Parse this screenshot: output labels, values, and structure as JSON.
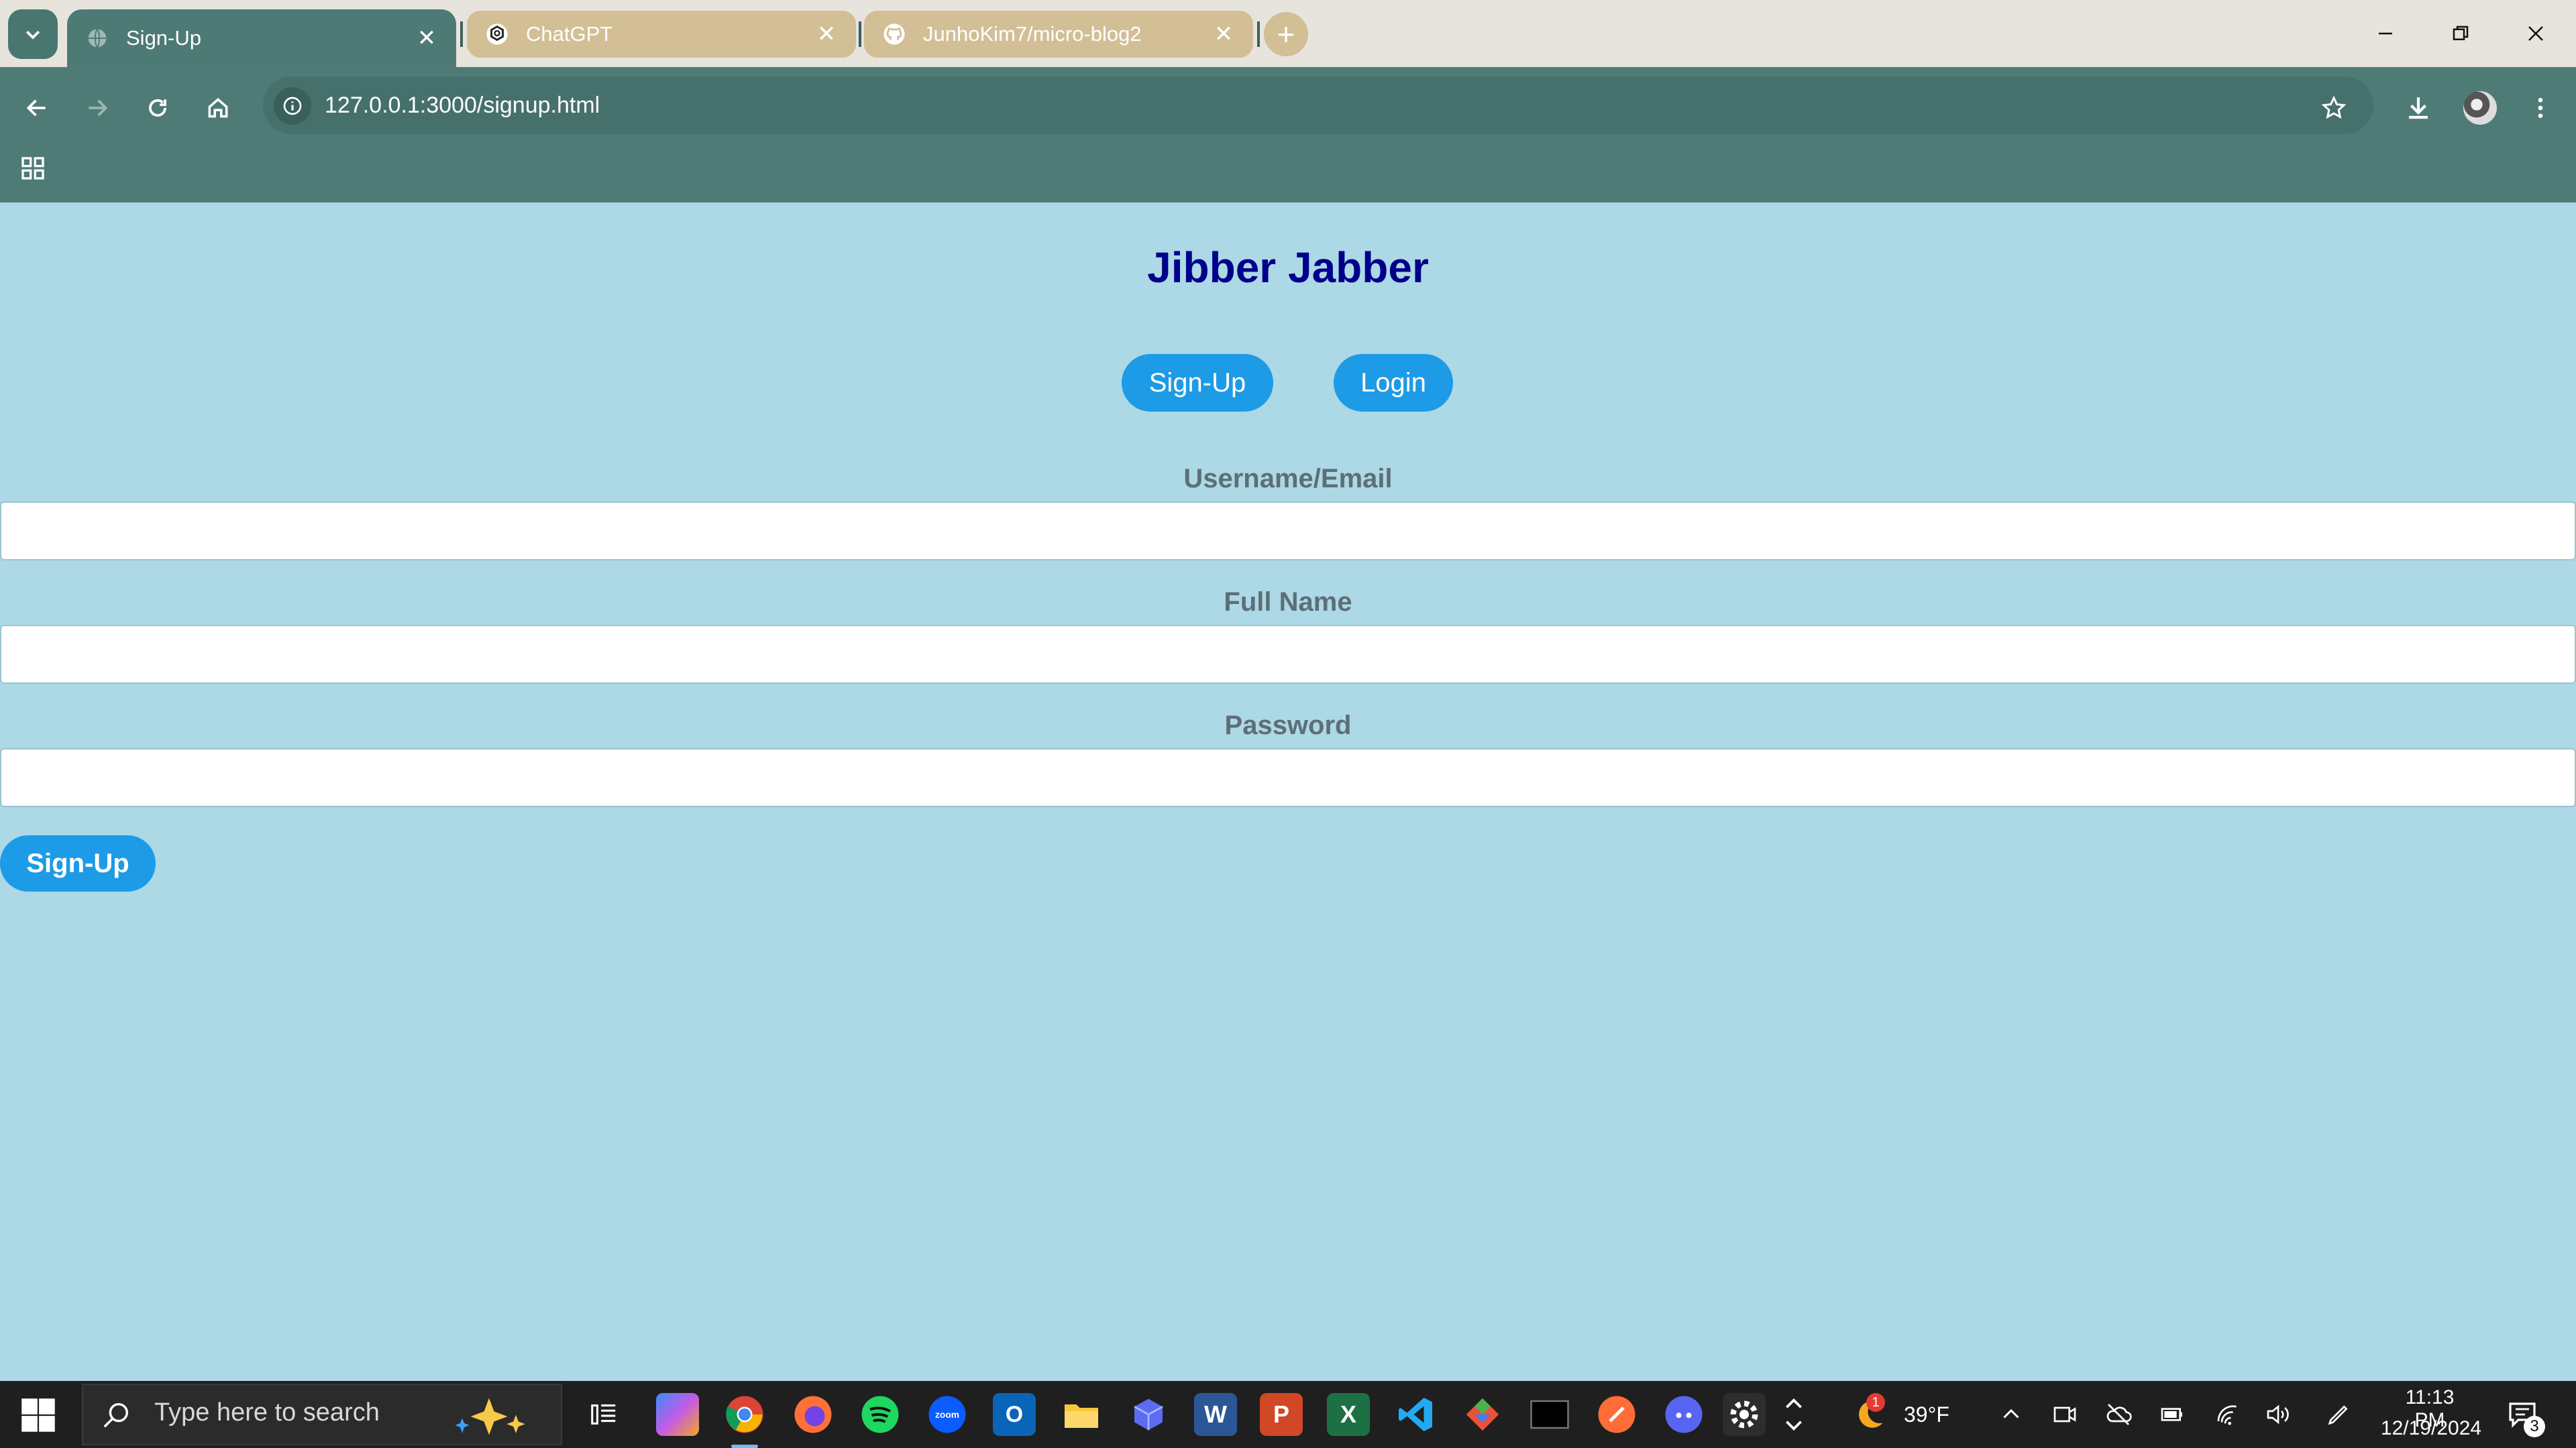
{
  "browser": {
    "tabs": [
      {
        "title": "Sign-Up",
        "active": true
      },
      {
        "title": "ChatGPT",
        "active": false
      },
      {
        "title": "JunhoKim7/micro-blog2",
        "active": false
      }
    ],
    "url": "127.0.0.1:3000/signup.html"
  },
  "page": {
    "site_title": "Jibber Jabber",
    "nav": {
      "signup_label": "Sign-Up",
      "login_label": "Login"
    },
    "form": {
      "username_label": "Username/Email",
      "username_value": "",
      "fullname_label": "Full Name",
      "fullname_value": "",
      "password_label": "Password",
      "password_value": "",
      "submit_label": "Sign-Up"
    }
  },
  "taskbar": {
    "search_placeholder": "Type here to search",
    "weather_temp": "39°F",
    "weather_badge": "1",
    "time": "11:13 PM",
    "date": "12/19/2024",
    "notification_count": "3"
  },
  "colors": {
    "page_bg": "#add8e6",
    "title": "#00008b",
    "button": "#1e9be6",
    "chrome_accent": "#4f7b77",
    "inactive_tab": "#d3bf96"
  }
}
